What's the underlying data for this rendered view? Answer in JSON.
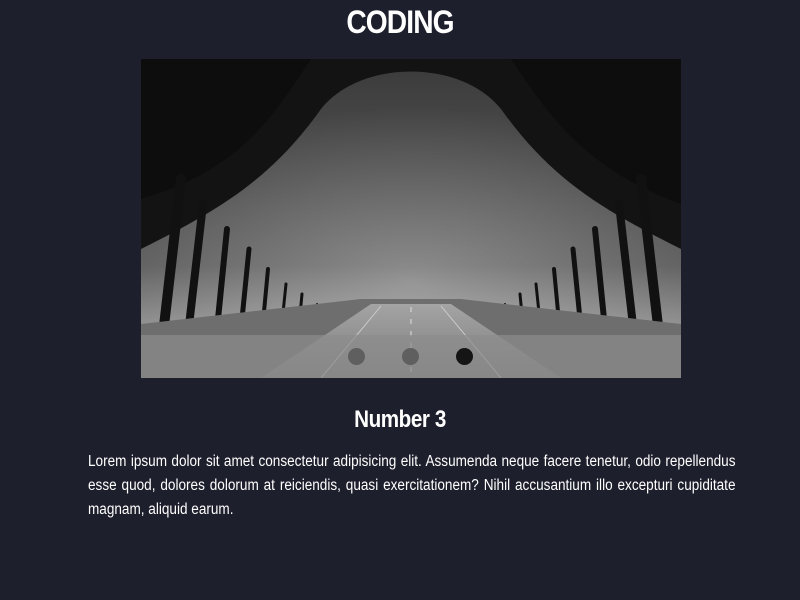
{
  "header": {
    "title": "CODING"
  },
  "slider": {
    "image": "tree-lined-road-photo",
    "active_index": 3,
    "dots": [
      {
        "name": "slide-1-dot",
        "state": "inactive"
      },
      {
        "name": "slide-2-dot",
        "state": "inactive"
      },
      {
        "name": "slide-3-dot",
        "state": "active"
      }
    ]
  },
  "content": {
    "heading": "Number 3",
    "text": "Lorem ipsum dolor sit amet consectetur adipisicing elit. Assumenda neque facere tenetur, odio repellendus esse quod, dolores dolorum at reiciendis, quasi exercitationem? Nihil accusantium illo excepturi cupiditate magnam, aliquid earum."
  },
  "colors": {
    "background": "#1d1f2c",
    "text": "#ffffff",
    "dot_inactive": "#5f5f5f",
    "dot_active": "#151515"
  }
}
